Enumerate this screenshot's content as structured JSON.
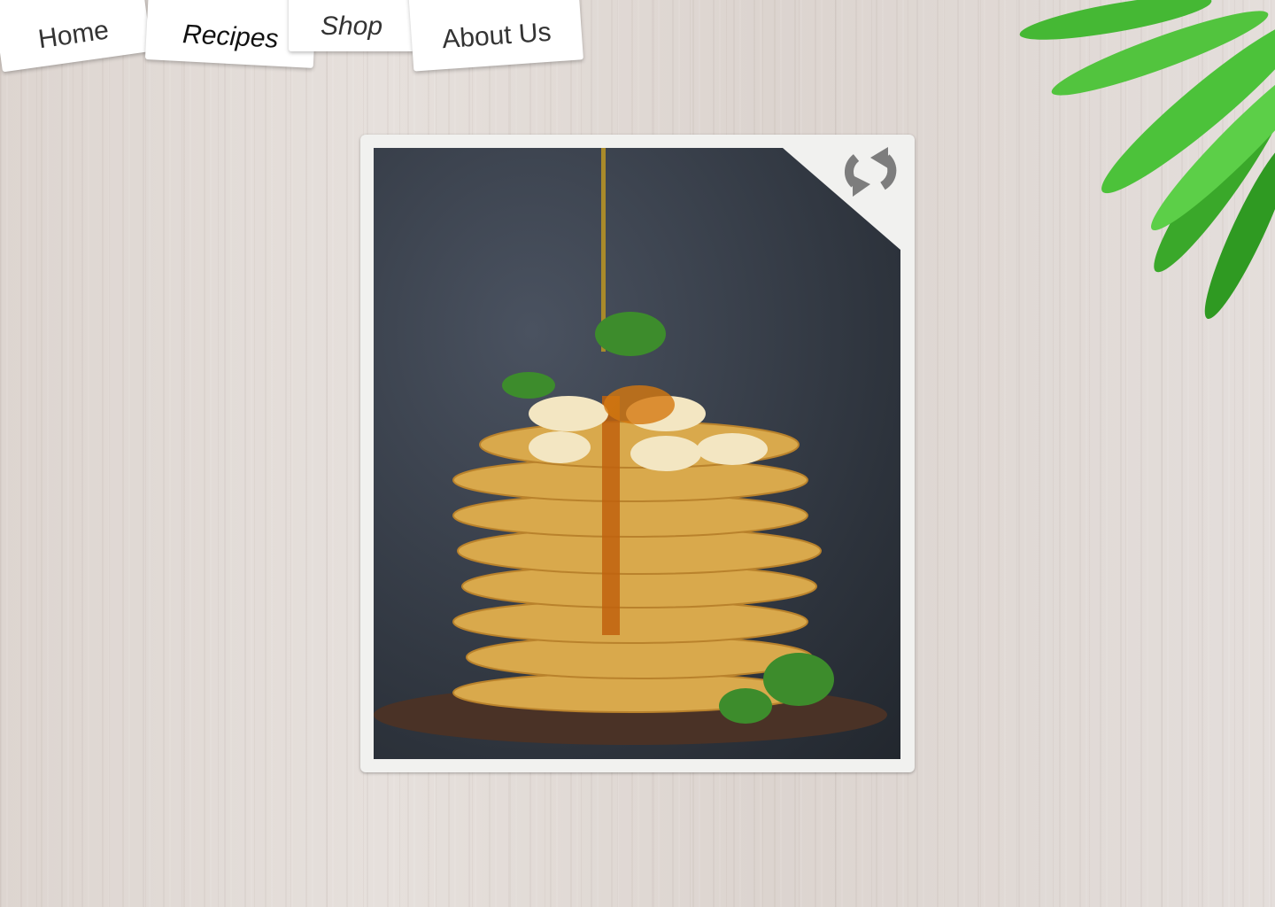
{
  "nav": {
    "items": [
      {
        "label": "Home"
      },
      {
        "label": "Recipes",
        "active": true
      },
      {
        "label": "Shop"
      },
      {
        "label": "About Us"
      }
    ]
  },
  "card": {
    "image_alt": "Stack of pancakes with banana, almonds, mint and syrup",
    "refresh_icon": "refresh-icon"
  },
  "colors": {
    "card": "#f1f1ef",
    "icon": "#7d7d7d",
    "leaf": "#3cae2c"
  }
}
